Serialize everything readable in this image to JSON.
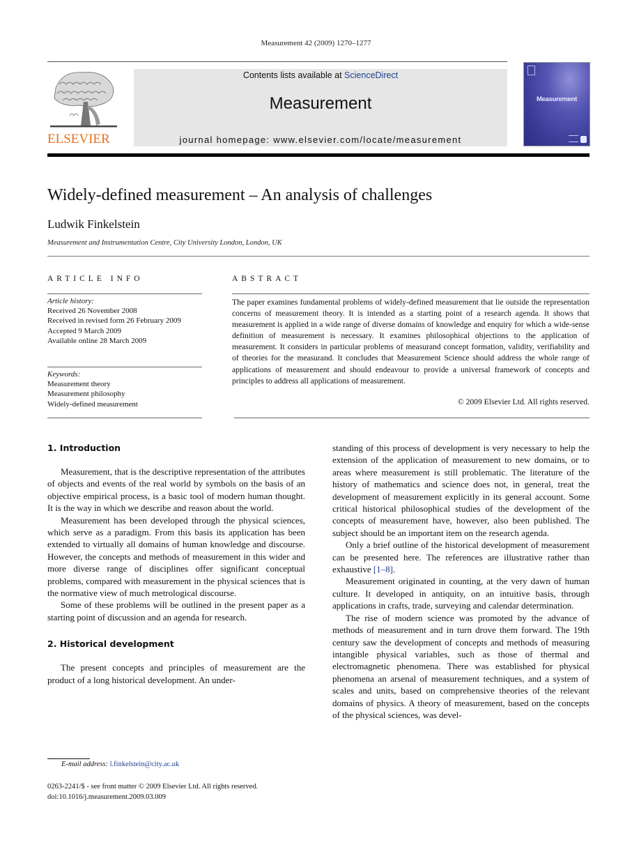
{
  "running_head": "Measurement 42 (2009) 1270–1277",
  "masthead": {
    "contents_prefix": "Contents lists available at ",
    "contents_link": "ScienceDirect",
    "journal_name": "Measurement",
    "homepage": "journal homepage: www.elsevier.com/locate/measurement",
    "publisher_logo_text": "ELSEVIER",
    "cover_title": "Measurement",
    "colors": {
      "publisher_orange": "#e9711c",
      "link_blue": "#1d3f8a",
      "banner_gray": "#e6e6e6",
      "cover_blue": "#3b3b98"
    }
  },
  "article": {
    "title": "Widely-defined measurement – An analysis of challenges",
    "author": "Ludwik Finkelstein",
    "affiliation": "Measurement and Instrumentation Centre, City University London, London, UK"
  },
  "article_info": {
    "heading": "ARTICLE INFO",
    "history_label": "Article history:",
    "history": [
      "Received 26 November 2008",
      "Received in revised form 26 February 2009",
      "Accepted 9 March 2009",
      "Available online 28 March 2009"
    ],
    "keywords_label": "Keywords:",
    "keywords": [
      "Measurement theory",
      "Measurement philosophy",
      "Widely-defined measurement"
    ]
  },
  "abstract": {
    "heading": "ABSTRACT",
    "text": "The paper examines fundamental problems of widely-defined measurement that lie outside the representation concerns of measurement theory. It is intended as a starting point of a research agenda. It shows that measurement is applied in a wide range of diverse domains of knowledge and enquiry for which a wide-sense definition of measurement is necessary. It examines philosophical objections to the application of measurement. It considers in particular problems of measurand concept formation, validity, verifiability and of theories for the measurand. It concludes that Measurement Science should address the whole range of applications of measurement and should endeavour to provide a universal framework of concepts and principles to address all applications of measurement.",
    "copyright": "© 2009 Elsevier Ltd. All rights reserved."
  },
  "body": {
    "section1": {
      "heading": "1.  Introduction",
      "paragraphs": [
        "Measurement, that is the descriptive representation of the attributes of objects and events of the real world by symbols on the basis of an objective empirical process, is a basic tool of modern human thought. It is the way in which we describe and reason about the world.",
        "Measurement has been developed through the physical sciences, which serve as a paradigm. From this basis its application has been extended to virtually all domains of human knowledge and discourse. However, the concepts and methods of measurement in this wider and more diverse range of disciplines offer significant conceptual problems, compared with measurement in the physical sciences that is the normative view of much metrological discourse.",
        "Some of these problems will be outlined in the present paper as a starting point of discussion and an agenda for research."
      ]
    },
    "section2": {
      "heading": "2.  Historical development",
      "paragraph_left": "The present concepts and principles of measurement are the product of a long historical development. An under-",
      "continuation": "standing of this process of development is very necessary to help the extension of the application of measurement to new domains, or to areas where measurement is still problematic. The literature of the history of mathematics and science does not, in general, treat the development of measurement explicitly in its general account. Some critical historical philosophical studies of the development of the concepts of measurement have, however, also been published. The subject should be an important item on the research agenda.",
      "p_outline_before": "Only a brief outline of the historical development of measurement can be presented here. The references are illustrative rather than exhaustive ",
      "p_outline_cite": "[1–8]",
      "p_outline_after": ".",
      "p_counting": "Measurement originated in counting, at the very dawn of human culture. It developed in antiquity, on an intuitive basis, through applications in crafts, trade, surveying and calendar determination.",
      "p_science": "The rise of modern science was promoted by the advance of methods of measurement and in turn drove them forward. The 19th century saw the development of concepts and methods of measuring intangible physical variables, such as those of thermal and electromagnetic phenomena. There was established for physical phenomena an arsenal of measurement techniques, and a system of scales and units, based on comprehensive theories of the relevant domains of physics. A theory of measurement, based on the concepts of the physical sciences, was devel-"
    }
  },
  "footnote": {
    "label": "E-mail address:",
    "email": "l.finkelstein@city.ac.uk"
  },
  "front_matter": {
    "issn_line": "0263-2241/$ - see front matter © 2009 Elsevier Ltd. All rights reserved.",
    "doi": "doi:10.1016/j.measurement.2009.03.009"
  }
}
